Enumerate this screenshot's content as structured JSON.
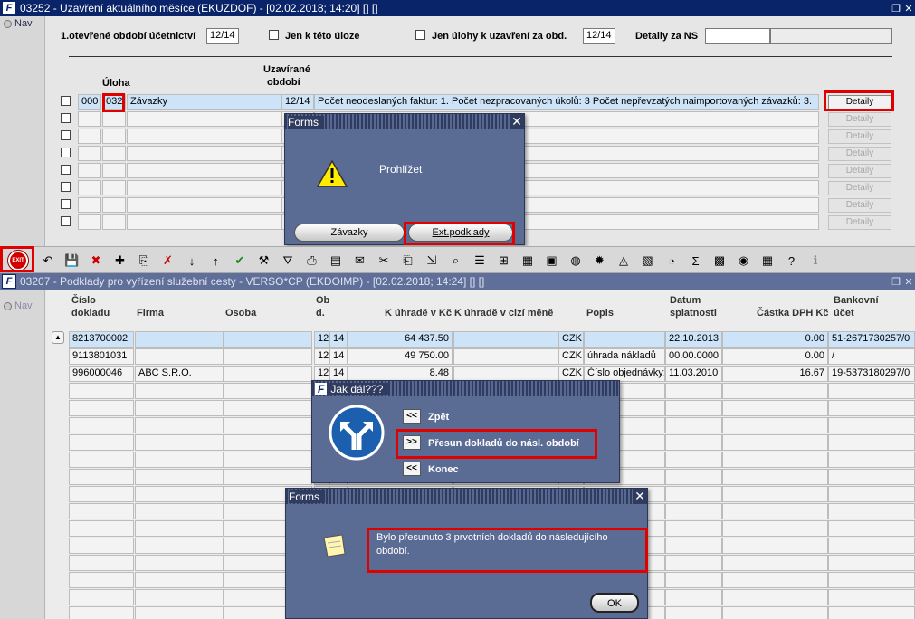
{
  "window1": {
    "title": "03252 - Uzavření aktuálního měsíce (EKUZDOF) - [02.02.2018; 14:20] [] []",
    "nav": "Nav",
    "first_open_label": "1.otevřené období účetnictví",
    "first_open_value": "12/14",
    "only_task_label": "Jen k této úloze",
    "only_close_label": "Jen úlohy k uzavření za obd.",
    "only_close_value": "12/14",
    "details_ns_label": "Detaily za NS",
    "col_uloha": "Úloha",
    "col_uzav1": "Uzavírané",
    "col_uzav2": "období",
    "row": {
      "c1": "000",
      "c2": "032",
      "name": "Závazky",
      "period": "12/14",
      "desc": "Počet neodeslaných faktur: 1. Počet nezpracovaných úkolů: 3 Počet nepřevzatých naimportovaných závazků: 3."
    },
    "detail_label": "Detaily"
  },
  "dialog_forms1": {
    "title": "Forms",
    "message": "Prohlížet",
    "btn1": "Závazky",
    "btn2": "Ext.podklady"
  },
  "toolbar": {
    "exit": "EXIT"
  },
  "window2": {
    "title": "03207 - Podklady pro vyřízení služební cesty - VERSO*CP (EKDOIMP) - [02.02.2018; 14:24] [] []",
    "nav": "Nav",
    "headers": {
      "cislo1": "Číslo",
      "cislo2": "dokladu",
      "firma": "Firma",
      "osoba": "Osoba",
      "ob1": "Ob",
      "ob2": "d.",
      "kuhrade": "K úhradě v Kč",
      "kuhrade_cizi": "K úhradě v cizí měně",
      "popis": "Popis",
      "datum1": "Datum",
      "datum2": "splatnosti",
      "castka": "Částka DPH Kč",
      "banka1": "Bankovní",
      "banka2": "účet"
    },
    "rows": [
      {
        "doklad": "8213700002",
        "firma": "",
        "o1": "12",
        "o2": "14",
        "kc": "64 437.50",
        "mena": "CZK",
        "popis": "",
        "datum": "22.10.2013",
        "dph": "0.00",
        "ucet": "51-2671730257/0"
      },
      {
        "doklad": "9113801031",
        "firma": "",
        "o1": "12",
        "o2": "14",
        "kc": "49 750.00",
        "mena": "CZK",
        "popis": "úhrada nákladů",
        "datum": "00.00.0000",
        "dph": "0.00",
        "ucet": "/"
      },
      {
        "doklad": "996000046",
        "firma": "ABC S.R.O.",
        "o1": "12",
        "o2": "14",
        "kc": "8.48",
        "mena": "CZK",
        "popis": "Číslo objednávky:",
        "datum": "11.03.2010",
        "dph": "16.67",
        "ucet": "19-5373180297/0"
      }
    ]
  },
  "dialog_jak": {
    "title": "Jak dál???",
    "opt1_btn": "<<",
    "opt1": "Zpět",
    "opt2_btn": ">>",
    "opt2": "Přesun dokladů do násl. období",
    "opt3_btn": "<<",
    "opt3": "Konec"
  },
  "dialog_forms2": {
    "title": "Forms",
    "message": "Bylo přesunuto 3 prvotních dokladů do následujícího období.",
    "ok": "OK"
  }
}
